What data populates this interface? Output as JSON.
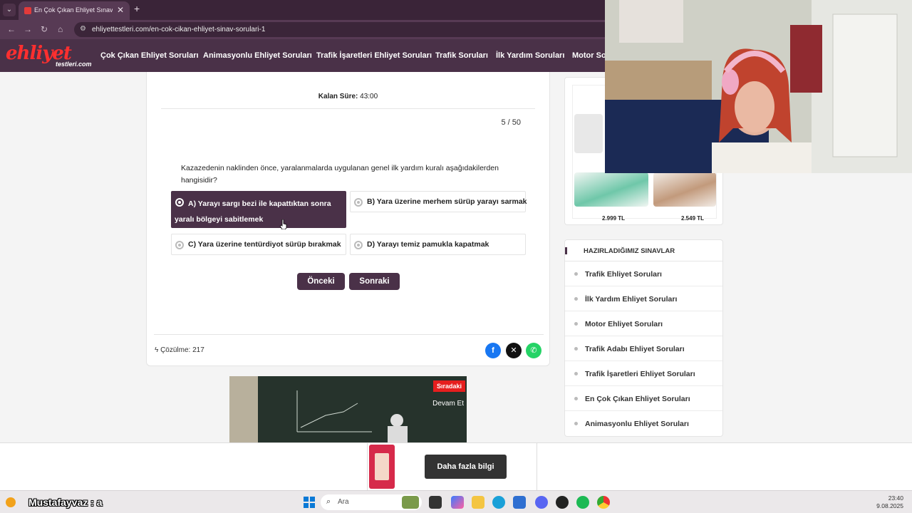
{
  "browser": {
    "tab_title": "En Çok Çıkan Ehliyet Sınav Sorul",
    "url": "ehliyettestleri.com/en-cok-cikan-ehliyet-sinav-sorulari-1"
  },
  "site": {
    "logo_main": "ehliyet",
    "logo_sub": "testleri.com",
    "nav": [
      "Çok Çıkan Ehliyet Soruları",
      "Animasyonlu Ehliyet Soruları",
      "Trafik İşaretleri Ehliyet Soruları",
      "Trafik Soruları",
      "İlk Yardım Soruları",
      "Motor Sor"
    ]
  },
  "quiz": {
    "timer_label": "Kalan Süre:",
    "timer_value": "43:00",
    "counter": "5 / 50",
    "question": "Kazazedenin naklinden önce, yaralanmalarda uygulanan genel ilk yardım kuralı aşağıdakilerden hangisidir?",
    "options": [
      {
        "label": "A) Yarayı sargı bezi ile kapattıktan sonra yaralı bölgeyi sabitlemek",
        "selected": true
      },
      {
        "label": "B) Yara üzerine merhem sürüp yarayı sarmak",
        "selected": false
      },
      {
        "label": "C) Yara üzerine tentürdiyot sürüp bırakmak",
        "selected": false
      },
      {
        "label": "D) Yarayı temiz pamukla kapatmak",
        "selected": false
      }
    ],
    "prev_label": "Önceki",
    "next_label": "Sonraki",
    "solves": "Çözülme: 217"
  },
  "video": {
    "next_label": "Sıradaki",
    "continue_label": "Devam Et"
  },
  "sidebar": {
    "prices": [
      "2.999 TL",
      "2.549 TL"
    ],
    "exams_title": "HAZIRLADIĞIMIZ SINAVLAR",
    "exams": [
      "Trafik Ehliyet Soruları",
      "İlk Yardım Ehliyet Soruları",
      "Motor Ehliyet Soruları",
      "Trafik Adabı Ehliyet Soruları",
      "Trafik İşaretleri Ehliyet Soruları",
      "En Çok Çıkan Ehliyet Soruları",
      "Animasyonlu Ehliyet Soruları"
    ]
  },
  "bottom_ad": {
    "button_label": "Daha fazla bilgi"
  },
  "taskbar": {
    "overlay_name": "Mustafayvaz : a",
    "search_placeholder": "Ara",
    "time": "23:40",
    "date": "9.08.2025"
  },
  "colors": {
    "brand": "#4a3148",
    "logo_red": "#ff2f2f",
    "facebook": "#1877f2",
    "x": "#111111",
    "whatsapp": "#25d366"
  }
}
